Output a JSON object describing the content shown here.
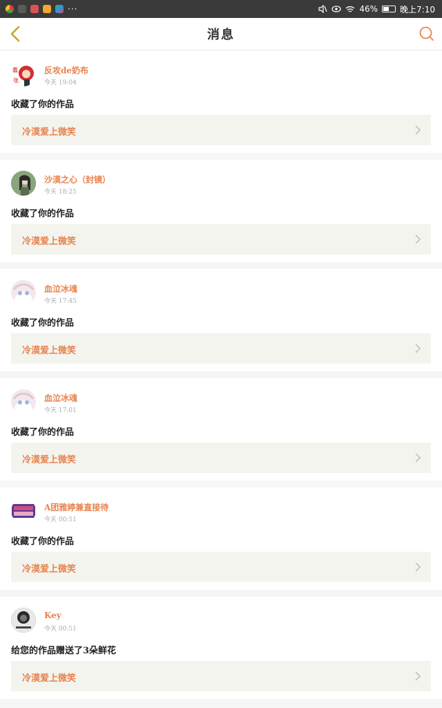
{
  "status_bar": {
    "battery": "46%",
    "time": "晚上7:10",
    "more": "···"
  },
  "header": {
    "title": "消息",
    "back_icon": "chevron-left-icon",
    "search_icon": "search-icon"
  },
  "colors": {
    "accent": "#e8834e",
    "back_icon": "#c8a42c",
    "work_bg": "#f4f4ee"
  },
  "messages": [
    {
      "user": "反攻de奶布",
      "time": "今天 19:04",
      "action": "收藏了你的作品",
      "work": "冷漠爱上微笑"
    },
    {
      "user": "沙漠之心（封镜）",
      "time": "今天 18:25",
      "action": "收藏了你的作品",
      "work": "冷漠爱上微笑"
    },
    {
      "user": "血泣冰魂",
      "time": "今天 17:45",
      "action": "收藏了你的作品",
      "work": "冷漠爱上微笑"
    },
    {
      "user": "血泣冰魂",
      "time": "今天 17:01",
      "action": "收藏了你的作品",
      "work": "冷漠爱上微笑"
    },
    {
      "user": "A团雅婷兼直接待",
      "time": "今天 00:51",
      "action": "收藏了你的作品",
      "work": "冷漠爱上微笑"
    },
    {
      "user": "Key",
      "time": "今天 00:51",
      "action": "给您的作品赠送了3朵鲜花",
      "work": "冷漠爱上微笑"
    }
  ]
}
